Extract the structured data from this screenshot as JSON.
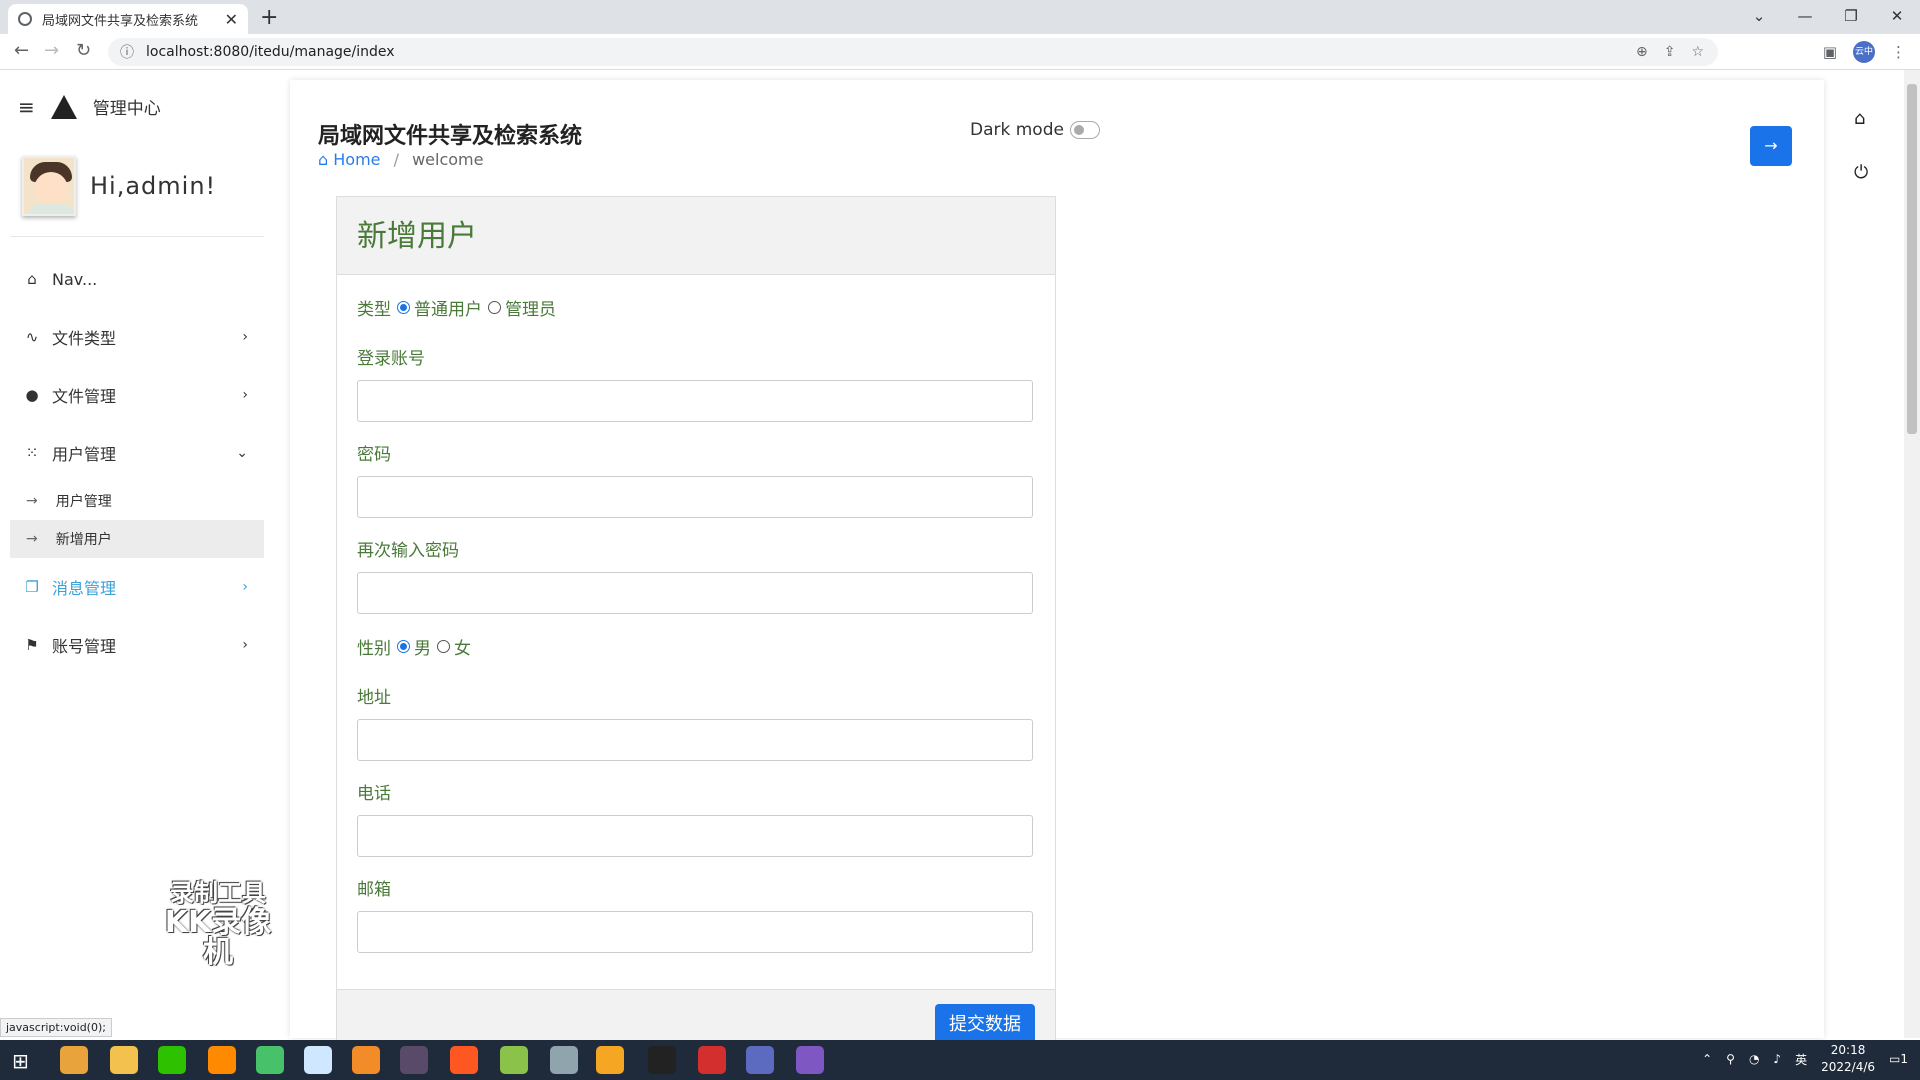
{
  "browser": {
    "tab_title": "局域网文件共享及检索系统",
    "url": "localhost:8080/itedu/manage/index",
    "status": "javascript:void(0);"
  },
  "sidebar": {
    "title": "管理中心",
    "greeting": "Hi,admin!",
    "menu": [
      {
        "label": "Nav...",
        "icon": "home-icon"
      },
      {
        "label": "文件类型",
        "icon": "pulse-icon"
      },
      {
        "label": "文件管理",
        "icon": "skype-icon"
      },
      {
        "label": "用户管理",
        "icon": "grid-icon"
      },
      {
        "label": "消息管理",
        "icon": "copy-icon"
      },
      {
        "label": "账号管理",
        "icon": "flag-icon"
      }
    ],
    "submenu": [
      "用户管理",
      "新增用户"
    ]
  },
  "header": {
    "title": "局域网文件共享及检索系统",
    "crumb_home": "Home",
    "crumb_sep": "/",
    "crumb_current": "welcome",
    "dark_mode": "Dark mode"
  },
  "form": {
    "title": "新增用户",
    "type_label": "类型",
    "type_options": [
      "普通用户",
      "管理员"
    ],
    "type_selected": "普通用户",
    "account": "登录账号",
    "password": "密码",
    "password2": "再次输入密码",
    "gender_label": "性别",
    "gender_options": [
      "男",
      "女"
    ],
    "gender_selected": "男",
    "address": "地址",
    "phone": "电话",
    "email": "邮箱",
    "submit": "提交数据"
  },
  "watermark": {
    "line1": "录制工具",
    "line2": "KK录像机"
  },
  "taskbar": {
    "time": "20:18",
    "date": "2022/4/6",
    "ime": "英",
    "profile": "云中",
    "notif": "1"
  },
  "colors": {
    "accent": "#1a73e8",
    "label_green": "#4a7a3a",
    "menu_active": "#3aa0d8"
  }
}
